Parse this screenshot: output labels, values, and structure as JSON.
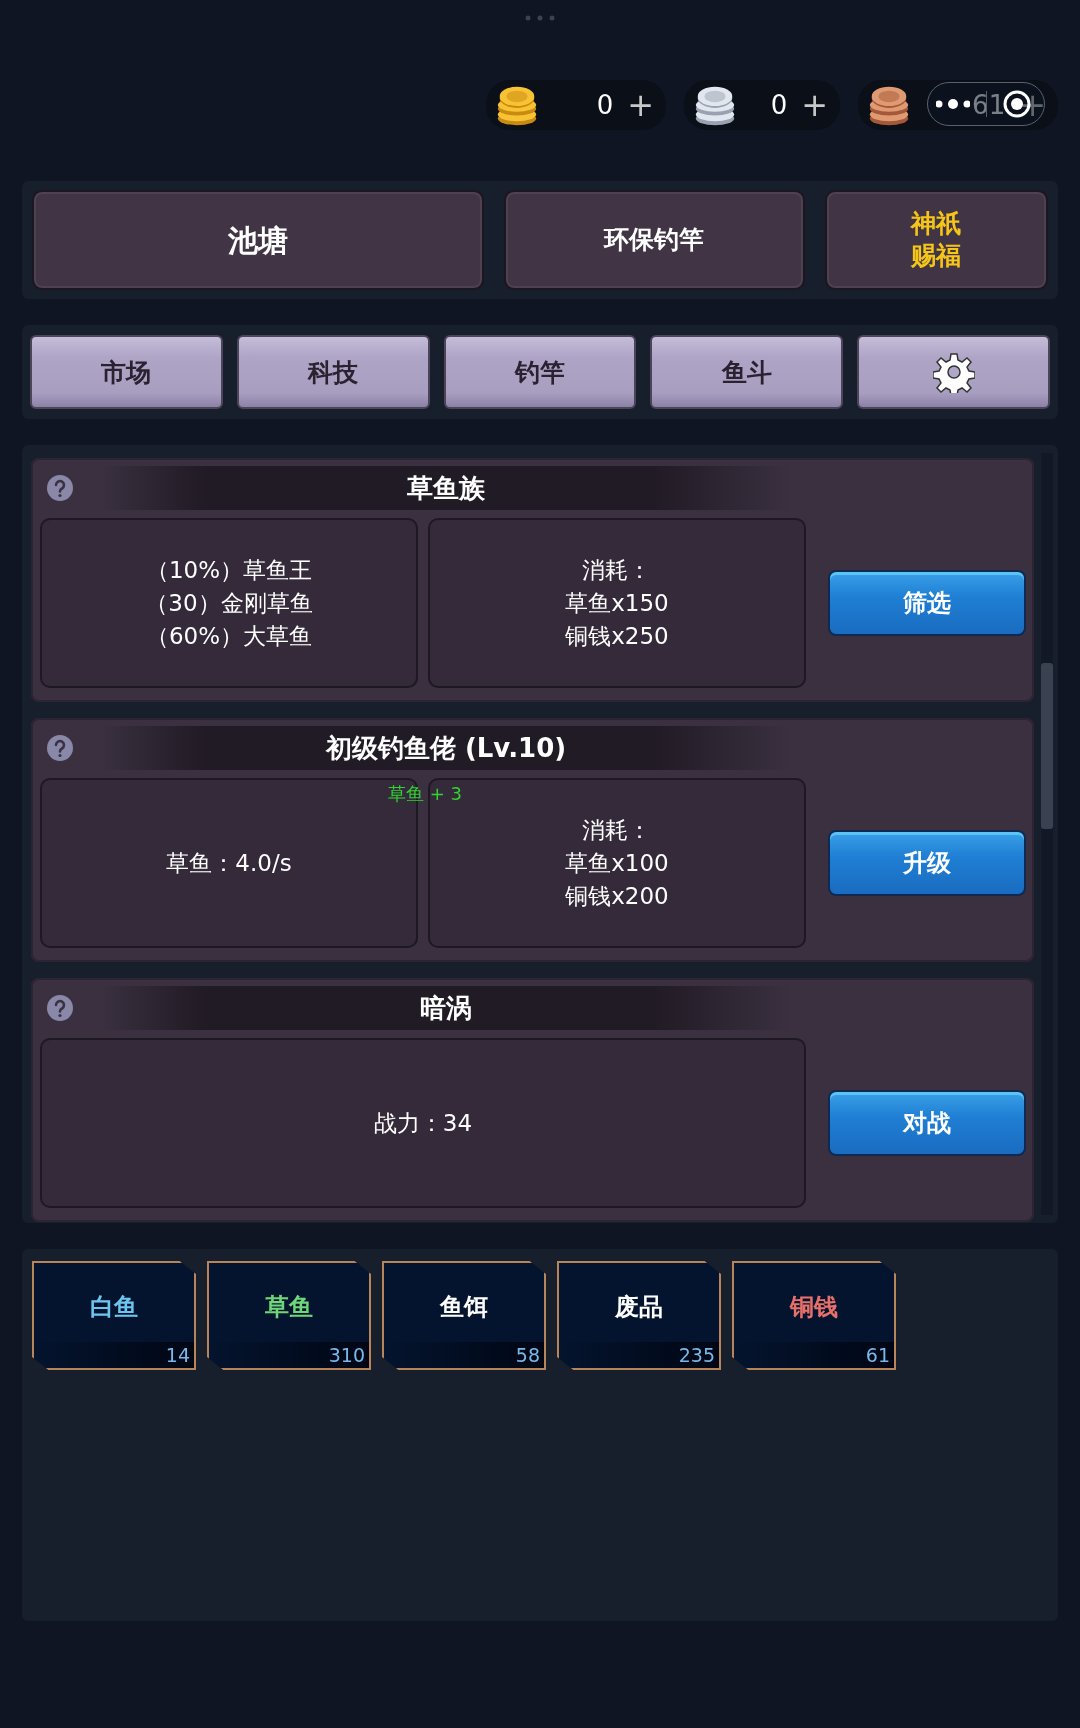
{
  "currencies": [
    {
      "kind": "gold",
      "value": "0",
      "plus": "+"
    },
    {
      "kind": "silver",
      "value": "0",
      "plus": "+"
    },
    {
      "kind": "copper",
      "value": "61",
      "plus": "+"
    }
  ],
  "top_buttons": [
    {
      "lines": [
        "池塘"
      ],
      "highlight": false
    },
    {
      "lines": [
        "环保钓竿"
      ],
      "highlight": false
    },
    {
      "lines": [
        "神祇",
        "赐福"
      ],
      "highlight": true
    }
  ],
  "nav": [
    {
      "kind": "text",
      "label": "市场"
    },
    {
      "kind": "text",
      "label": "科技"
    },
    {
      "kind": "text",
      "label": "钓竿"
    },
    {
      "kind": "text",
      "label": "鱼斗"
    },
    {
      "kind": "settings"
    }
  ],
  "cards": [
    {
      "title": "草鱼族",
      "panels": [
        {
          "lines": [
            "（10%）草鱼王",
            "（30）金刚草鱼",
            "（60%）大草鱼"
          ]
        },
        {
          "lines": [
            "消耗：",
            "草鱼x150",
            "铜钱x250"
          ]
        }
      ],
      "button": "筛选"
    },
    {
      "title": "初级钓鱼佬 (Lv.10)",
      "float_text": "草鱼 + 3",
      "panels": [
        {
          "lines": [
            "草鱼：4.0/s"
          ]
        },
        {
          "lines": [
            "消耗：",
            "草鱼x100",
            "铜钱x200"
          ]
        }
      ],
      "button": "升级"
    },
    {
      "title": "暗涡",
      "panels": [
        {
          "lines": [
            "战力：34"
          ]
        }
      ],
      "button": "对战"
    }
  ],
  "inventory": [
    {
      "label": "白鱼",
      "count": "14",
      "color": "#6ec6f0"
    },
    {
      "label": "草鱼",
      "count": "310",
      "color": "#6fd67a"
    },
    {
      "label": "鱼饵",
      "count": "58",
      "color": "#ffffff"
    },
    {
      "label": "废品",
      "count": "235",
      "color": "#ffffff"
    },
    {
      "label": "铜钱",
      "count": "61",
      "color": "#e8706a"
    }
  ]
}
